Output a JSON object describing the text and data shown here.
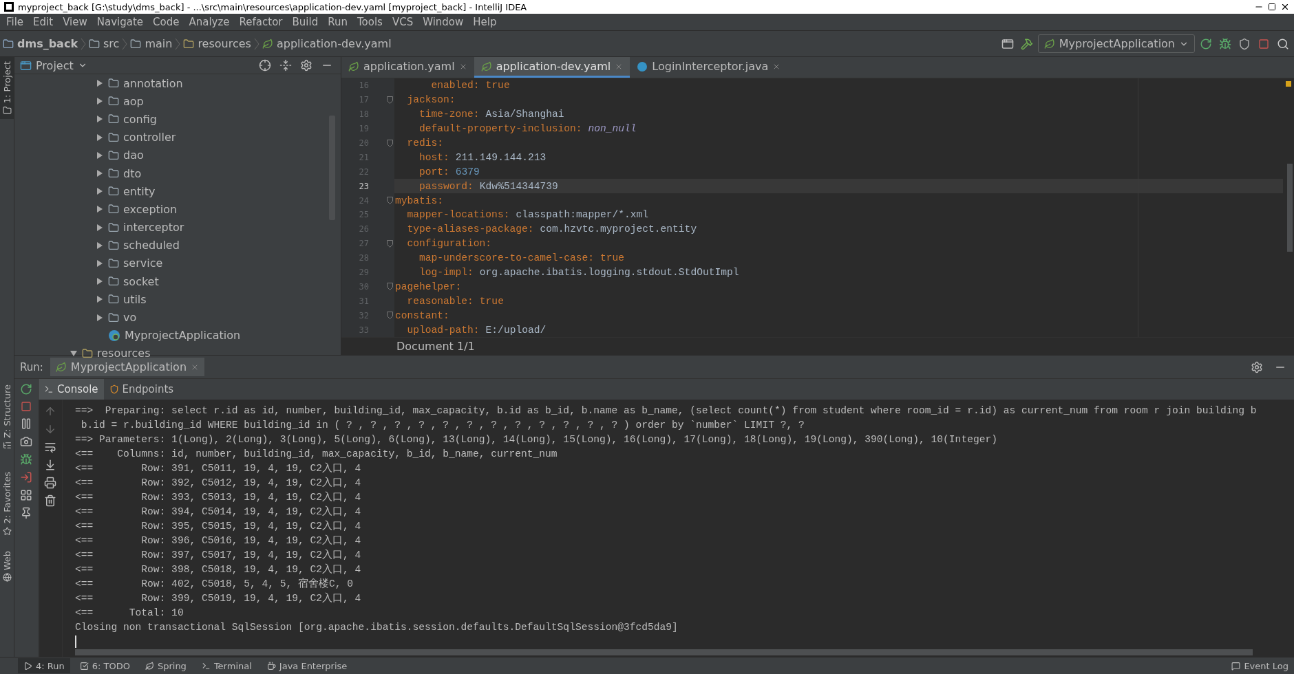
{
  "window": {
    "title": "myproject_back [G:\\study\\dms_back] - ...\\src\\main\\resources\\application-dev.yaml [myproject_back] - IntelliJ IDEA"
  },
  "menu": [
    "File",
    "Edit",
    "View",
    "Navigate",
    "Code",
    "Analyze",
    "Refactor",
    "Build",
    "Run",
    "Tools",
    "VCS",
    "Window",
    "Help"
  ],
  "breadcrumbs": [
    {
      "label": "dms_back",
      "kind": "module"
    },
    {
      "label": "src",
      "kind": "folder"
    },
    {
      "label": "main",
      "kind": "folder"
    },
    {
      "label": "resources",
      "kind": "resources"
    },
    {
      "label": "application-dev.yaml",
      "kind": "yaml"
    }
  ],
  "run_config": "MyprojectApplication",
  "side_tools": [
    {
      "label": "1: Project",
      "kind": "project",
      "selected": true
    },
    {
      "label": "Z: Structure",
      "kind": "structure",
      "selected": false
    },
    {
      "label": "2: Favorites",
      "kind": "favorites",
      "selected": false
    },
    {
      "label": "Web",
      "kind": "web",
      "selected": false
    }
  ],
  "project_panel": {
    "title": "Project",
    "tree": [
      {
        "children": [
          {
            "label": "annotation",
            "kind": "folder",
            "expanded": false
          },
          {
            "label": "aop",
            "kind": "folder",
            "expanded": false
          },
          {
            "label": "config",
            "kind": "folder",
            "expanded": false
          },
          {
            "label": "controller",
            "kind": "folder",
            "expanded": false
          },
          {
            "label": "dao",
            "kind": "folder",
            "expanded": false
          },
          {
            "label": "dto",
            "kind": "folder",
            "expanded": false
          },
          {
            "label": "entity",
            "kind": "folder",
            "expanded": false
          },
          {
            "label": "exception",
            "kind": "folder",
            "expanded": false
          },
          {
            "label": "interceptor",
            "kind": "folder",
            "expanded": false
          },
          {
            "label": "scheduled",
            "kind": "folder",
            "expanded": false
          },
          {
            "label": "service",
            "kind": "folder",
            "expanded": false
          },
          {
            "label": "socket",
            "kind": "folder",
            "expanded": false
          },
          {
            "label": "utils",
            "kind": "folder",
            "expanded": false
          },
          {
            "label": "vo",
            "kind": "folder",
            "expanded": false
          },
          {
            "label": "MyprojectApplication",
            "kind": "class"
          }
        ]
      },
      {
        "label": "resources",
        "kind": "resources",
        "expanded": true
      }
    ]
  },
  "editor_tabs": [
    {
      "label": "application.yaml",
      "kind": "yaml",
      "selected": false
    },
    {
      "label": "application-dev.yaml",
      "kind": "yaml",
      "selected": true
    },
    {
      "label": "LoginInterceptor.java",
      "kind": "java",
      "selected": false
    }
  ],
  "code_lines": [
    {
      "number": "16",
      "key": "      enabled:",
      "value": "true",
      "kind": "keyword",
      "current": false
    },
    {
      "number": "17",
      "key": "  jackson:",
      "current": false
    },
    {
      "number": "18",
      "key": "    time-zone:",
      "value": "Asia/Shanghai",
      "kind": "string",
      "current": false
    },
    {
      "number": "19",
      "key": "    default-property-inclusion:",
      "value": "non_null",
      "kind": "constant",
      "current": false
    },
    {
      "number": "20",
      "key": "  redis:",
      "current": false
    },
    {
      "number": "21",
      "key": "    host:",
      "value": "211.149.144.213",
      "kind": "string",
      "current": false
    },
    {
      "number": "22",
      "key": "    port:",
      "value": "6379",
      "kind": "number",
      "current": false
    },
    {
      "number": "23",
      "key": "    password:",
      "value": "Kdw%514344739",
      "kind": "string",
      "current": true
    },
    {
      "number": "24",
      "key": "mybatis:",
      "current": false
    },
    {
      "number": "25",
      "key": "  mapper-locations:",
      "value": "classpath:mapper/*.xml",
      "kind": "string",
      "current": false
    },
    {
      "number": "26",
      "key": "  type-aliases-package:",
      "value": "com.hzvtc.myproject.entity",
      "kind": "string",
      "current": false
    },
    {
      "number": "27",
      "key": "  configuration:",
      "current": false
    },
    {
      "number": "28",
      "key": "    map-underscore-to-camel-case:",
      "value": "true",
      "kind": "keyword",
      "current": false
    },
    {
      "number": "29",
      "key": "    log-impl:",
      "value": "org.apache.ibatis.logging.stdout.StdOutImpl",
      "kind": "string",
      "current": false
    },
    {
      "number": "30",
      "key": "pagehelper:",
      "current": false
    },
    {
      "number": "31",
      "key": "  reasonable:",
      "value": "true",
      "kind": "keyword",
      "current": false
    },
    {
      "number": "32",
      "key": "constant:",
      "current": false
    },
    {
      "number": "33",
      "key": "  upload-path:",
      "value": "E:/upload/",
      "kind": "string",
      "current": false
    }
  ],
  "editor_breadcrumb": "Document 1/1",
  "run_panel": {
    "label": "Run:",
    "tab": "MyprojectApplication",
    "console_tabs": [
      {
        "label": "Console",
        "kind": "console",
        "selected": true
      },
      {
        "label": "Endpoints",
        "kind": "endpoints",
        "selected": false
      }
    ],
    "lines": [
      "==>  Preparing: select r.id as id, number, building_id, max_capacity, b.id as b_id, b.name as b_name, (select count(*) from student where room_id = r.id) as current_num from room r join building b",
      " b.id = r.building_id WHERE building_id in ( ? , ? , ? , ? , ? , ? , ? , ? , ? , ? , ? , ? ) order by `number` LIMIT ?, ?",
      "==> Parameters: 1(Long), 2(Long), 3(Long), 5(Long), 6(Long), 13(Long), 14(Long), 15(Long), 16(Long), 17(Long), 18(Long), 19(Long), 390(Long), 10(Integer)",
      "<==    Columns: id, number, building_id, max_capacity, b_id, b_name, current_num",
      "<==        Row: 391, C5011, 19, 4, 19, C2入口, 4",
      "<==        Row: 392, C5012, 19, 4, 19, C2入口, 4",
      "<==        Row: 393, C5013, 19, 4, 19, C2入口, 4",
      "<==        Row: 394, C5014, 19, 4, 19, C2入口, 4",
      "<==        Row: 395, C5015, 19, 4, 19, C2入口, 4",
      "<==        Row: 396, C5016, 19, 4, 19, C2入口, 4",
      "<==        Row: 397, C5017, 19, 4, 19, C2入口, 4",
      "<==        Row: 398, C5018, 19, 4, 19, C2入口, 4",
      "<==        Row: 402, C5018, 5, 4, 5, 宿舍楼C, 0",
      "<==        Row: 399, C5019, 19, 4, 19, C2入口, 4",
      "<==      Total: 10",
      "Closing non transactional SqlSession [org.apache.ibatis.session.defaults.DefaultSqlSession@3fcd5da9]"
    ]
  },
  "bottom_tabs": [
    {
      "label": "4: Run",
      "kind": "run",
      "selected": true
    },
    {
      "label": "6: TODO",
      "kind": "todo",
      "selected": false
    },
    {
      "label": "Spring",
      "kind": "spring",
      "selected": false
    },
    {
      "label": "Terminal",
      "kind": "terminal",
      "selected": false
    },
    {
      "label": "Java Enterprise",
      "kind": "enterprise",
      "selected": false
    }
  ],
  "event_log": "Event Log"
}
